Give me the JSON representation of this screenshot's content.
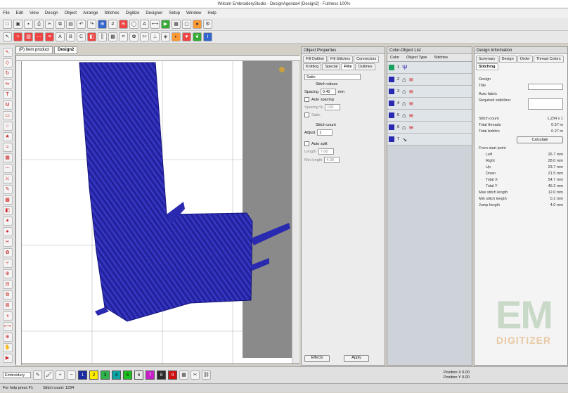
{
  "title": "Wilcom EmbroideryStudio - DesignAgenda4 [Design2] - Fullness 100%",
  "menu": [
    "File",
    "Edit",
    "View",
    "Design",
    "Object",
    "Arrange",
    "Stitches",
    "Digitize",
    "Designer",
    "Setup",
    "Window",
    "Help"
  ],
  "doc_tabs": [
    "(P) Item product",
    "Design2"
  ],
  "object_properties": {
    "title": "Object Properties",
    "tabs": [
      "Fill Outline",
      "Fill Stitches",
      "Connectors",
      "Knitting",
      "Special",
      "Fills",
      "Outlines"
    ],
    "fill_type": "Satin",
    "stitch_values_label": "Stitch values",
    "spacing_label": "Spacing",
    "spacing_value": "0.40",
    "spacing_unit": "mm",
    "auto_spacing_label": "Auto spacing",
    "auto_spacing_pct_label": "Spacing %",
    "auto_spacing_pct": "100",
    "satin_label": "Satin",
    "stitch_count_label": "Stitch count",
    "adjust_label": "Adjust",
    "adjust_value": "1",
    "auto_split_label": "Auto split",
    "length_label": "Length",
    "length_value": "7.00",
    "min_length_label": "Min length",
    "min_length_value": "4.00",
    "effects_label": "Effects",
    "apply_label": "Apply"
  },
  "color_film": {
    "title": "Color-Object List",
    "columns": [
      "Color",
      "Object Type",
      "Stitches"
    ],
    "rows": [
      {
        "num": "1",
        "stitches": "—"
      },
      {
        "num": "2",
        "stitches": "—"
      },
      {
        "num": "3",
        "stitches": "—"
      },
      {
        "num": "4",
        "stitches": "—"
      },
      {
        "num": "5",
        "stitches": "—"
      },
      {
        "num": "6",
        "stitches": "—"
      },
      {
        "num": "7",
        "stitches": "—"
      }
    ]
  },
  "design_info": {
    "title": "Design Information",
    "tabs": [
      "Summary",
      "Design",
      "Order",
      "Thread Colors",
      "Stitching"
    ],
    "design_label": "Design",
    "title_label": "Title",
    "auto_fabric_label": "Auto fabric",
    "required_stabilizer_label": "Required stabilizer",
    "stitch_count_label": "Stitch count",
    "stitch_count_value": "1,234 x 1",
    "trims_label": "Total threads",
    "trims_value": "0.57 m",
    "total_bobbin_label": "Total bobbin",
    "total_bobbin_value": "0.27 m",
    "calculate_label": "Calculate",
    "start_point_label": "From start point",
    "measures": [
      {
        "label": "Left",
        "value": "26.7 mm"
      },
      {
        "label": "Right",
        "value": "28.0 mm"
      },
      {
        "label": "Up",
        "value": "23.7 mm"
      },
      {
        "label": "Down",
        "value": "21.5 mm"
      },
      {
        "label": "Total X",
        "value": "54.7 mm"
      },
      {
        "label": "Total Y",
        "value": "45.2 mm"
      }
    ],
    "max_stitch_label": "Max stitch length",
    "max_stitch_value": "12.0 mm",
    "min_stitch_label": "Min stitch length",
    "min_stitch_value": "0.1 mm",
    "jumps_label": "Jump length",
    "jumps_value": "4.0 mm"
  },
  "bottom": {
    "design_label": "Embroidery",
    "color_swatches": [
      "#1a2aa0",
      "#ffeb00",
      "#2fb34a",
      "#0fa3a3",
      "#1fbf1f",
      "#e8e8e8",
      "#c81ec8",
      "#2c2c2c",
      "#d01010"
    ],
    "color_numbers": [
      "1",
      "2",
      "3",
      "4",
      "5",
      "6",
      "7",
      "8",
      "9"
    ],
    "position_x_label": "Position X",
    "position_x": "0.00",
    "position_y_label": "Position Y",
    "position_y": "0.00"
  },
  "status": {
    "left": "For help press F1",
    "right": "Stitch count: 1234"
  },
  "watermark": {
    "line1": "EM",
    "line2": "DIGITIZER"
  },
  "colors": {
    "thread": "#2a2ab0",
    "hoop": "#8a8a8a"
  }
}
